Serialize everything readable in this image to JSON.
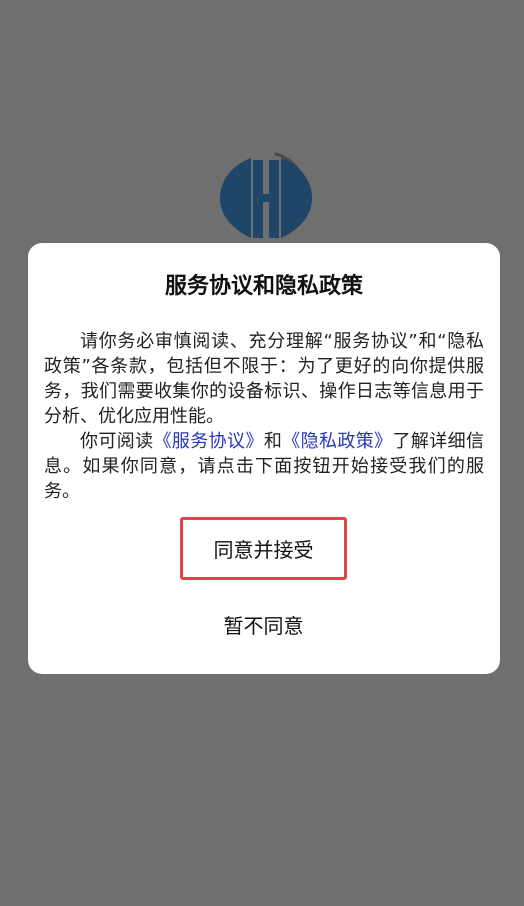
{
  "dialog": {
    "title": "服务协议和隐私政策",
    "paragraph1": "请你务必审慎阅读、充分理解“服务协议”和“隐私政策”各条款，包括但不限于：为了更好的向你提供服务，我们需要收集你的设备标识、操作日志等信息用于分析、优化应用性能。",
    "paragraph2_prefix": "你可阅读",
    "service_link": "《服务协议》",
    "paragraph2_and": "和",
    "privacy_link": "《隐私政策》",
    "paragraph2_suffix": "了解详细信息。如果你同意，请点击下面按钮开始接受我们的服务。",
    "agree_label": "同意并接受",
    "disagree_label": "暂不同意"
  },
  "colors": {
    "overlay": "#6f6f6f",
    "logo": "#1f4569",
    "link": "#2a36b8",
    "highlight_border": "#e04545"
  }
}
